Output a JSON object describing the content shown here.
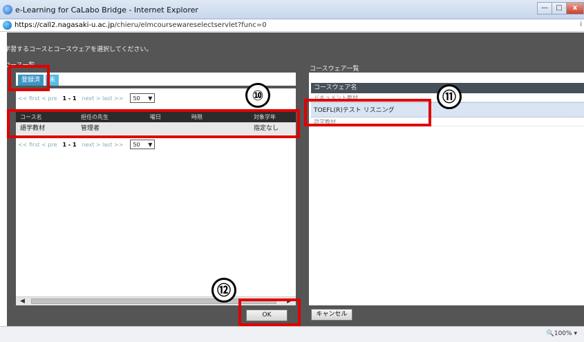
{
  "window": {
    "title": "e-Learning for CaLabo Bridge - Internet Explorer",
    "url_host": "https://call2.nagasaki-u.ac.jp",
    "url_path": "/chieru/elmcoursewareselectservlet?func=0",
    "min_label": "—",
    "max_label": "□",
    "close_label": "x"
  },
  "page": {
    "instruction": "学習するコースとコースウェアを選択してください。",
    "course_list_label": "コース一覧",
    "courseware_list_label": "コースウェア一覧"
  },
  "tabs": [
    {
      "label": "登録済"
    },
    {
      "label": "未"
    }
  ],
  "pager": {
    "first": "<< first",
    "prev": "< pre",
    "current": "1 - 1",
    "next": "next >",
    "last": "last >>",
    "page_size": "50"
  },
  "course_table": {
    "headers": [
      "コース名",
      "担任の先生",
      "曜日",
      "時限",
      "対象学年"
    ],
    "rows": [
      [
        "語学教材",
        "管理者",
        "",
        "",
        "指定なし"
      ]
    ]
  },
  "courseware_table": {
    "header": "コースウェア名",
    "rows": [
      "ドキュメント教材",
      "TOEFL(R)テスト リスニング",
      "語学教材"
    ]
  },
  "buttons": {
    "ok": "OK",
    "cancel": "キャンセル"
  },
  "status": {
    "zoom": "100%"
  },
  "annotations": {
    "n10": "⑩",
    "n11": "⑪",
    "n12": "⑫"
  },
  "colors": {
    "highlight": "#e00000",
    "tab_active": "#57bde6",
    "header_dark": "#2c2c2c"
  }
}
